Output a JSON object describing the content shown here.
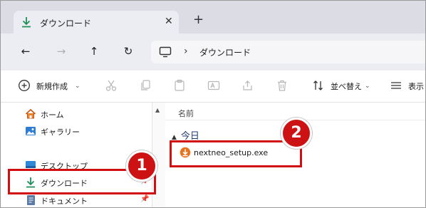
{
  "tab": {
    "title": "ダウンロード",
    "close": "✕",
    "new_tab": "+"
  },
  "nav": {
    "back": "←",
    "forward": "→",
    "up": "↑",
    "refresh": "↻"
  },
  "address": {
    "separator": "›",
    "crumb": "ダウンロード"
  },
  "commands": {
    "new_label": "新規作成",
    "new_chevron": "⌄",
    "sort_label": "並べ替え",
    "sort_chevron": "⌄",
    "view_label": "表示"
  },
  "sidebar": {
    "items": [
      {
        "label": "ホーム",
        "icon": "home-icon"
      },
      {
        "label": "ギャラリー",
        "icon": "gallery-icon"
      },
      {
        "label": "デスクトップ",
        "icon": "desktop-icon"
      },
      {
        "label": "ダウンロード",
        "icon": "download-icon",
        "selected": true,
        "pin": "📌"
      },
      {
        "label": "ドキュメント",
        "icon": "document-icon",
        "pin": "📌"
      }
    ]
  },
  "filelist": {
    "column_name": "名前",
    "group_caret": "▲",
    "group_label": "今日",
    "files": [
      {
        "name": "nextneo_setup.exe",
        "icon": "installer-icon"
      }
    ]
  },
  "annotations": {
    "badge1": "1",
    "badge2": "2",
    "color": "#d20f10"
  },
  "colors": {
    "download_green": "#1f8f5a",
    "installer_orange": "#e8711a",
    "tab_strip": "#dcdce4"
  }
}
